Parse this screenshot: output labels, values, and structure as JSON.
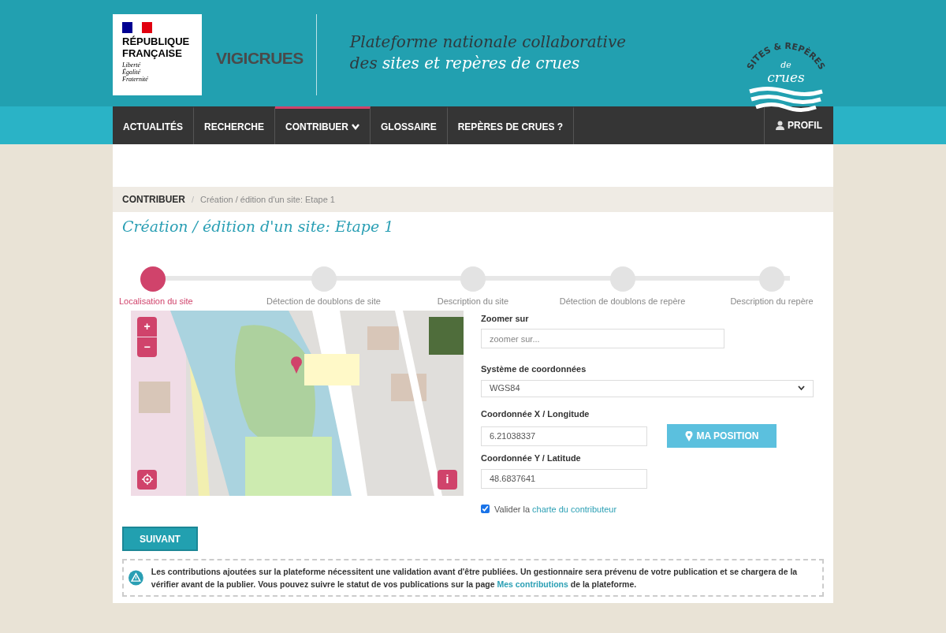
{
  "header": {
    "republic": [
      "RÉPUBLIQUE",
      "FRANÇAISE"
    ],
    "motto": [
      "Liberté",
      "Égalité",
      "Fraternité"
    ],
    "vigicrues": "VIGICRUES",
    "tagline_line1": "Plateforme nationale collaborative",
    "tagline_prefix": "des ",
    "tagline_highlight": "sites et repères de crues",
    "badge": {
      "arc": "SITES & REPÈRES",
      "small": "de",
      "big": "crues"
    }
  },
  "nav": {
    "items": [
      {
        "label": "ACTUALITÉS",
        "selected": false,
        "dropdown": false
      },
      {
        "label": "RECHERCHE",
        "selected": false,
        "dropdown": false
      },
      {
        "label": "CONTRIBUER",
        "selected": true,
        "dropdown": true
      },
      {
        "label": "GLOSSAIRE",
        "selected": false,
        "dropdown": false
      },
      {
        "label": "REPÈRES DE CRUES ?",
        "selected": false,
        "dropdown": false
      }
    ],
    "profile": "PROFIL"
  },
  "breadcrumb": [
    "CONTRIBUER",
    "/",
    "Création / édition d'un site: Etape 1"
  ],
  "title": "Création / édition d'un site: Etape 1",
  "steps": [
    {
      "label": "Localisation du site",
      "selected": true
    },
    {
      "label": "Détection de doublons de site",
      "selected": false
    },
    {
      "label": "Description du site",
      "selected": false
    },
    {
      "label": "Détection de doublons de repère",
      "selected": false
    },
    {
      "label": "Description du repère",
      "selected": false
    }
  ],
  "map": {
    "zoom_in": "+",
    "zoom_out": "−",
    "info": "i"
  },
  "form": {
    "zoom_label": "Zoomer sur",
    "zoom_placeholder": "zoomer sur...",
    "crs_label": "Système de coordonnées",
    "crs_value": "WGS84",
    "x_label": "Coordonnée X / Longitude",
    "x_value": "6.21038337",
    "position_button": "MA POSITION",
    "y_label": "Coordonnée Y / Latitude",
    "y_value": "48.6837641",
    "charter": {
      "checked": true,
      "text": "Valider la ",
      "link": "charte du contributeur"
    }
  },
  "next_button": "SUIVANT",
  "notice": {
    "text": "Les contributions ajoutées sur la plateforme nécessitent une validation avant d'être publiées. Un gestionnaire sera prévenu de votre publication et se chargera de la vérifier avant de la publier. Vous pouvez suivre le statut de vos publications sur la page ",
    "link": "Mes contributions",
    "after": " de la plateforme."
  }
}
